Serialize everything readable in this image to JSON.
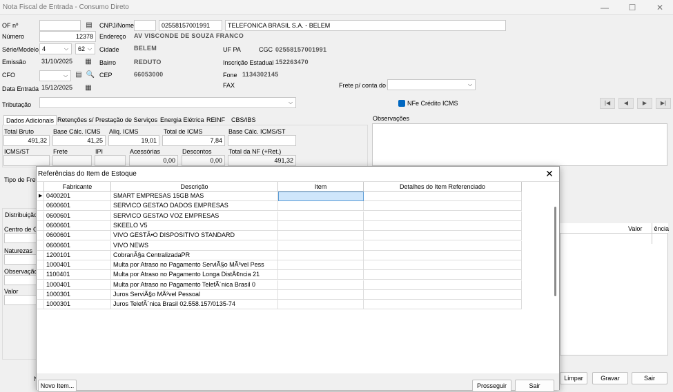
{
  "window": {
    "title": "Nota Fiscal de Entrada - Consumo Direto",
    "minimize": "—",
    "maximize": "☐",
    "close": "✕"
  },
  "header": {
    "nf_label": "OF nº",
    "nf_value": "",
    "cnpj_label": "CNPJ/Nome",
    "cnpj_value": "02558157001991",
    "nome_value": "TELEFONICA BRASIL S.A. - BELEM",
    "numero_label": "Número",
    "numero_value": "12378",
    "endereco_label": "Endereço",
    "endereco_value": "AV VISCONDE DE SOUZA FRANCO",
    "serie_label": "Série/Modelo",
    "serie_value": "4",
    "modelo_value": "62",
    "cidade_label": "Cidade",
    "cidade_value": "BELEM",
    "uf_label": "UF PA",
    "cgc_label": "CGC",
    "cgc_value": "02558157001991",
    "emissao_label": "Emissão",
    "emissao_value": "31/10/2025",
    "bairro_label": "Bairro",
    "bairro_value": "REDUTO",
    "ie_label": "Inscrição Estadual",
    "ie_value": "152263470",
    "cfo_label": "CFO",
    "cfo_value": "",
    "cep_label": "CEP",
    "cep_value": "66053000",
    "fone_label": "Fone",
    "fone_value": "1134302145",
    "data_entrada_label": "Data Entrada",
    "data_entrada_value": "15/12/2025",
    "fax_label": "FAX",
    "frete_label": "Frete p/ conta do",
    "frete_value": "",
    "tributacao_label": "Tributação",
    "tributacao_value": "",
    "nfe_credito_label": "NFe Crédito ICMS"
  },
  "nav": {
    "first": "|◀",
    "prev": "◀",
    "next": "▶",
    "last": "▶|"
  },
  "tabs": [
    "Dados Adicionais",
    "Retenções s/ Prestação de Serviços",
    "Energia Elétrica",
    "REINF",
    "CBS/IBS"
  ],
  "observacoes_label": "Observações",
  "totals": {
    "total_bruto_label": "Total Bruto",
    "total_bruto": "491,32",
    "base_icms_label": "Base Cálc. ICMS",
    "base_icms": "41,25",
    "aliq_icms_label": "Aliq. ICMS",
    "aliq_icms": "19,01",
    "total_icms_label": "Total de ICMS",
    "total_icms": "7,84",
    "base_icms_st_label": "Base Cálc. ICMS/ST",
    "base_icms_st": "",
    "icms_st_label": "ICMS/ST",
    "icms_st": "",
    "frete_label": "Frete",
    "frete": "",
    "ipi_label": "IPI",
    "ipi": "",
    "acessorias_label": "Acessórias",
    "acessorias": "0,00",
    "descontos_label": "Descontos",
    "descontos": "0,00",
    "total_nf_label": "Total da NF (+Ret.)",
    "total_nf": "491,32"
  },
  "background_fragments": {
    "tipo_frete": "Tipo de Frete",
    "distribuicao": "Distribuição",
    "centro_custo": "Centro de Custo",
    "naturezas": "Naturezas",
    "observacao": "Observação",
    "valor": "Valor",
    "grid_valor": "Valor",
    "grid_referencia": "Referência",
    "n_button": "N"
  },
  "bottom_buttons": {
    "limpar": "Limpar",
    "gravar": "Gravar",
    "sair": "Sair"
  },
  "modal": {
    "title": "Referências do Item de Estoque",
    "close": "✕",
    "columns": [
      "Fabricante",
      "Descrição",
      "Item",
      "Detalhes do Item Referenciado"
    ],
    "rows": [
      {
        "fabricante": "0400201",
        "descricao": "SMART EMPRESAS 15GB MAS",
        "item": "",
        "detalhes": ""
      },
      {
        "fabricante": "0600601",
        "descricao": "SERVICO GESTAO DADOS EMPRESAS",
        "item": "",
        "detalhes": ""
      },
      {
        "fabricante": "0600601",
        "descricao": "SERVICO GESTAO VOZ EMPRESAS",
        "item": "",
        "detalhes": ""
      },
      {
        "fabricante": "0600601",
        "descricao": "SKEELO V5",
        "item": "",
        "detalhes": ""
      },
      {
        "fabricante": "0600601",
        "descricao": "VIVO GESTÃ•O DISPOSITIVO STANDARD",
        "item": "",
        "detalhes": ""
      },
      {
        "fabricante": "0600601",
        "descricao": "VIVO NEWS",
        "item": "",
        "detalhes": ""
      },
      {
        "fabricante": "1200101",
        "descricao": "CobranÃ§a CentralizadaPR",
        "item": "",
        "detalhes": ""
      },
      {
        "fabricante": "1000401",
        "descricao": "Multa por Atraso no Pagamento ServiÃ§o MÃ³vel Pess",
        "item": "",
        "detalhes": ""
      },
      {
        "fabricante": "1100401",
        "descricao": "Multa por Atraso no Pagamento Longa DistÃ¢ncia 21",
        "item": "",
        "detalhes": ""
      },
      {
        "fabricante": "1000401",
        "descricao": "Multa por Atraso no Pagamento TelefÃ´nica Brasil 0",
        "item": "",
        "detalhes": ""
      },
      {
        "fabricante": "1000301",
        "descricao": "Juros ServiÃ§o MÃ³vel Pessoal",
        "item": "",
        "detalhes": ""
      },
      {
        "fabricante": "1000301",
        "descricao": "Juros TelefÃ´nica Brasil 02.558.157/0135-74",
        "item": "",
        "detalhes": ""
      }
    ],
    "novo_item": "Novo Item...",
    "prosseguir": "Prosseguir",
    "sair": "Sair"
  },
  "colors": {
    "selected_cell": "#cfe6fb",
    "checkbox_accent": "#0067c0"
  }
}
